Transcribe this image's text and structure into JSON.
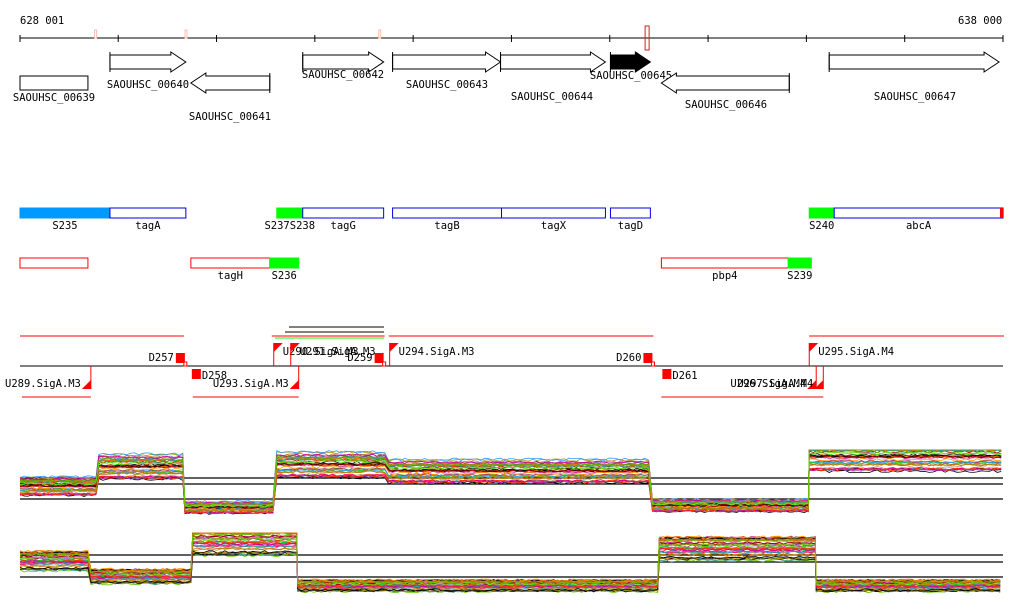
{
  "ruler": {
    "start_label": "628 001",
    "end_label": "638 000",
    "start": 628001,
    "end": 638000,
    "tick_step": 1000,
    "markers": [
      628770,
      629690,
      631660
    ],
    "highlight": 634380
  },
  "genes": [
    {
      "id": "SAOUHSC_00639",
      "start": 628001,
      "end": 628692,
      "strand": "none",
      "filled": false
    },
    {
      "id": "SAOUHSC_00640",
      "start": 628916,
      "end": 629688,
      "strand": "+",
      "filled": false
    },
    {
      "id": "SAOUHSC_00641",
      "start": 629739,
      "end": 630542,
      "strand": "-",
      "filled": false
    },
    {
      "id": "SAOUHSC_00642",
      "start": 630877,
      "end": 631700,
      "strand": "+",
      "filled": false
    },
    {
      "id": "SAOUHSC_00643",
      "start": 631791,
      "end": 632889,
      "strand": "+",
      "filled": false
    },
    {
      "id": "SAOUHSC_00644",
      "start": 632889,
      "end": 633956,
      "strand": "+",
      "filled": false
    },
    {
      "id": "SAOUHSC_00645",
      "start": 634007,
      "end": 634413,
      "strand": "+",
      "filled": true
    },
    {
      "id": "SAOUHSC_00646",
      "start": 634525,
      "end": 635826,
      "strand": "-",
      "filled": false
    },
    {
      "id": "SAOUHSC_00647",
      "start": 636232,
      "end": 637960,
      "strand": "+",
      "filled": false
    }
  ],
  "annotations_plus": [
    {
      "label": "S235",
      "start": 628001,
      "end": 628916,
      "kind": "fill",
      "color": "#0099ff"
    },
    {
      "label": "tagA",
      "start": 628916,
      "end": 629688,
      "kind": "outline",
      "color": "#0000dd"
    },
    {
      "label": "S237S238",
      "start": 630613,
      "end": 630877,
      "kind": "fill",
      "color": "#00ff00"
    },
    {
      "label": "tagG",
      "start": 630877,
      "end": 631700,
      "kind": "outline",
      "color": "#0000dd"
    },
    {
      "label": "tagB",
      "start": 631791,
      "end": 632899,
      "kind": "outline",
      "color": "#0000dd"
    },
    {
      "label": "tagX",
      "start": 632899,
      "end": 633956,
      "kind": "outline",
      "color": "#0000dd"
    },
    {
      "label": "tagD",
      "start": 634007,
      "end": 634413,
      "kind": "outline",
      "color": "#0000dd"
    },
    {
      "label": "S240",
      "start": 636029,
      "end": 636283,
      "kind": "fill",
      "color": "#00ff00"
    },
    {
      "label": "abcA",
      "start": 636283,
      "end": 638000,
      "kind": "outline",
      "color": "#0000dd",
      "end_mark": "#ff0000"
    }
  ],
  "annotations_minus": [
    {
      "label": "",
      "start": 628001,
      "end": 628692,
      "kind": "outline",
      "color": "#ff0000"
    },
    {
      "label": "tagH",
      "start": 629739,
      "end": 630542,
      "kind": "outline",
      "color": "#ff0000"
    },
    {
      "label": "S236",
      "start": 630542,
      "end": 630836,
      "kind": "fill",
      "color": "#00ff00"
    },
    {
      "label": "pbp4",
      "start": 634525,
      "end": 635816,
      "kind": "outline",
      "color": "#ff0000"
    },
    {
      "label": "S239",
      "start": 635816,
      "end": 636050,
      "kind": "fill",
      "color": "#00ff00"
    }
  ],
  "segments": {
    "plus_lines": [
      [
        628001,
        629668
      ],
      [
        630562,
        631710
      ],
      [
        631751,
        634444
      ],
      [
        636029,
        638010
      ]
    ],
    "minus_lines": [
      [
        628021,
        628722
      ],
      [
        629759,
        630836
      ],
      [
        634525,
        636172
      ]
    ],
    "down_labels": [
      {
        "label": "D257",
        "pos": 629678,
        "side": "plus"
      },
      {
        "label": "D258",
        "pos": 629749,
        "side": "minus"
      },
      {
        "label": "D259",
        "pos": 631700,
        "side": "plus"
      },
      {
        "label": "D260",
        "pos": 634434,
        "side": "plus"
      },
      {
        "label": "D261",
        "pos": 634535,
        "side": "minus"
      }
    ],
    "up_labels": [
      {
        "label": "U289.SigA.M3",
        "pos": 628722,
        "side": "minus"
      },
      {
        "label": "U290.SigA.M3",
        "pos": 630582,
        "side": "plus"
      },
      {
        "label": "U291.SigA.M3",
        "pos": 630755,
        "side": "plus"
      },
      {
        "label": "U293.SigA.M3",
        "pos": 630836,
        "side": "minus"
      },
      {
        "label": "U294.SigA.M3",
        "pos": 631761,
        "side": "plus"
      },
      {
        "label": "U296.SigA.M4",
        "pos": 636100,
        "side": "minus"
      },
      {
        "label": "U297.SigA.M4",
        "pos": 636172,
        "side": "minus"
      },
      {
        "label": "U295.SigA.M4",
        "pos": 636029,
        "side": "plus"
      }
    ]
  },
  "expression": {
    "plus": [
      [
        628001,
        628803,
        0.45
      ],
      [
        628803,
        629678,
        0.75
      ],
      [
        629678,
        630613,
        0.12
      ],
      [
        630613,
        631751,
        0.78
      ],
      [
        631751,
        634434,
        0.68
      ],
      [
        634434,
        636029,
        0.15
      ],
      [
        636029,
        638000,
        0.9
      ]
    ],
    "minus": [
      [
        628001,
        628722,
        0.55
      ],
      [
        628722,
        629759,
        0.3
      ],
      [
        629759,
        630826,
        0.85
      ],
      [
        630826,
        634504,
        0.15
      ],
      [
        634504,
        636100,
        0.75
      ],
      [
        636100,
        638000,
        0.15
      ]
    ],
    "line_colors": [
      "#ff3300",
      "#cc6600",
      "#999900",
      "#66cc00",
      "#00cc33",
      "#3399ff",
      "#cc3399",
      "#993366",
      "#ff6633",
      "#cc9966",
      "#669900",
      "#ff0066",
      "#9966cc",
      "#339999",
      "#cc6633",
      "#ff9900",
      "#336699",
      "#990000",
      "#66ff33",
      "#cc0099"
    ]
  }
}
